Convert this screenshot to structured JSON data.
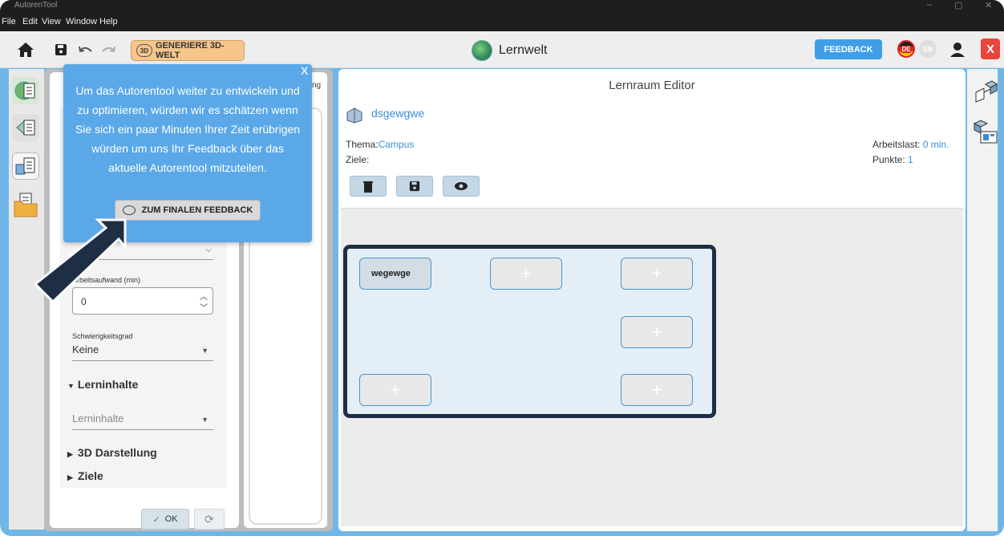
{
  "window": {
    "title": "AutorenTool",
    "controls": [
      "–",
      "▢",
      "✕"
    ]
  },
  "menu": [
    "File",
    "Edit",
    "View",
    "Window",
    "Help"
  ],
  "toolbar": {
    "generate_label": "GENERIERE 3D-WELT",
    "generate_badge": "3D",
    "world_title": "Lernwelt",
    "feedback_label": "FEEDBACK",
    "lang_de": "DE",
    "lang_en": "EN",
    "close_label": "X"
  },
  "popup": {
    "close": "X",
    "message": "Um das Autorentool weiter zu entwickeln und zu optimieren, würden wir es schätzen wenn Sie sich ein paar Minuten Ihrer Zeit erübrigen würden um uns Ihr Feedback über das aktuelle Autorentool mitzuteilen.",
    "button_label": "ZUM FINALEN FEEDBACK"
  },
  "properties": {
    "mid_header_fragment": "ng",
    "workload_label": "Arbeitsaufwand (min)",
    "workload_value": "0",
    "difficulty_label": "Schwierigkeitsgrad",
    "difficulty_value": "Keine",
    "section_content": "Lerninhalte",
    "content_placeholder": "Lerninhalte",
    "section_3d": "3D Darstellung",
    "section_goals": "Ziele",
    "ok_label": "OK"
  },
  "editor": {
    "title": "Lernraum Editor",
    "room_name": "dsgewgwe",
    "theme_label": "Thema:",
    "theme_value": "Campus",
    "goals_label": "Ziele:",
    "workload_label": "Arbeitslast:",
    "workload_value": "0 min.",
    "points_label": "Punkte:",
    "points_value": "1",
    "slots": [
      {
        "label": "wegewge",
        "filled": true
      },
      {
        "label": "+",
        "filled": false
      },
      {
        "label": "+",
        "filled": false
      },
      {
        "label": "+",
        "filled": false
      },
      {
        "label": "+",
        "filled": false
      },
      {
        "label": "+",
        "filled": false
      }
    ]
  }
}
